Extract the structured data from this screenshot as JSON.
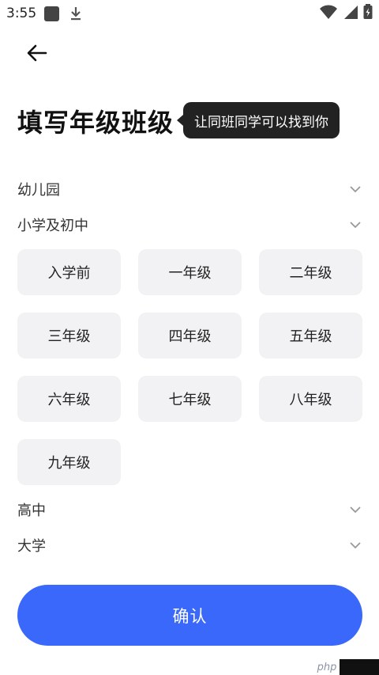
{
  "status_bar": {
    "time": "3:55",
    "icons": [
      "app-square-icon",
      "download-icon",
      "wifi-icon",
      "signal-icon",
      "battery-icon"
    ]
  },
  "header": {
    "back_icon": "arrow-left-icon"
  },
  "page": {
    "title": "填写年级班级",
    "tooltip": "让同班同学可以找到你"
  },
  "sections": [
    {
      "label": "幼儿园",
      "expanded": false
    },
    {
      "label": "小学及初中",
      "expanded": true
    },
    {
      "label": "高中",
      "expanded": false
    },
    {
      "label": "大学",
      "expanded": false
    }
  ],
  "grades": [
    "入学前",
    "一年级",
    "二年级",
    "三年级",
    "四年级",
    "五年级",
    "六年级",
    "七年级",
    "八年级",
    "九年级"
  ],
  "confirm_label": "确认",
  "watermark_text": "php",
  "colors": {
    "accent": "#3a68fb",
    "chip_bg": "#f2f2f4",
    "tooltip_bg": "#222222"
  }
}
